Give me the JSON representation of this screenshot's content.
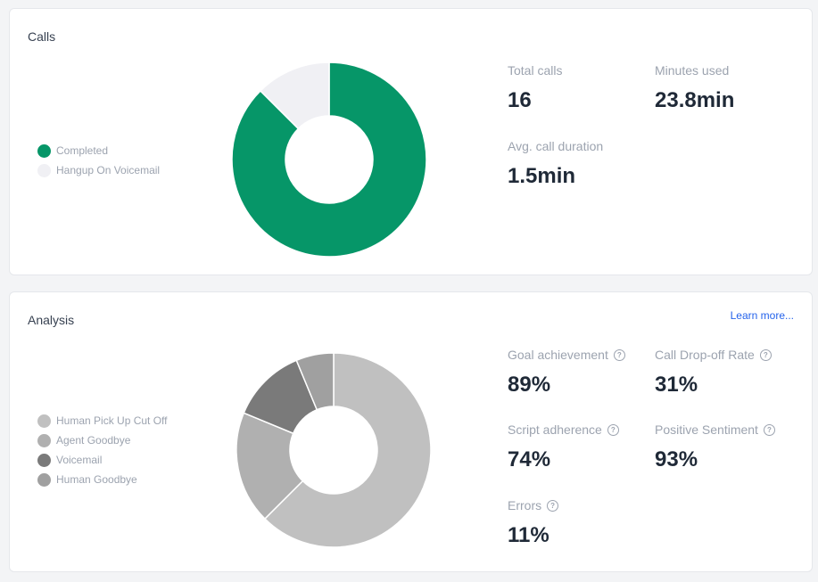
{
  "calls": {
    "title": "Calls",
    "legend": [
      {
        "label": "Completed",
        "color": "#069668"
      },
      {
        "label": "Hangup On Voicemail",
        "color": "#f0f0f4"
      }
    ],
    "chart_data": {
      "type": "pie",
      "donut": true,
      "categories": [
        "Completed",
        "Hangup On Voicemail"
      ],
      "values": [
        14,
        2
      ],
      "colors": [
        "#069668",
        "#f0f0f4"
      ]
    },
    "stats": {
      "total_calls_label": "Total calls",
      "total_calls_value": "16",
      "minutes_used_label": "Minutes used",
      "minutes_used_value": "23.8min",
      "avg_duration_label": "Avg. call duration",
      "avg_duration_value": "1.5min"
    }
  },
  "analysis": {
    "title": "Analysis",
    "learn_more": "Learn more...",
    "legend": [
      {
        "label": "Human Pick Up Cut Off",
        "color": "#c0c0c0"
      },
      {
        "label": "Agent Goodbye",
        "color": "#b0b0b0"
      },
      {
        "label": "Voicemail",
        "color": "#7a7a7a"
      },
      {
        "label": "Human Goodbye",
        "color": "#a0a0a0"
      }
    ],
    "chart_data": {
      "type": "pie",
      "donut": true,
      "categories": [
        "Human Pick Up Cut Off",
        "Agent Goodbye",
        "Voicemail",
        "Human Goodbye"
      ],
      "values": [
        10,
        3,
        2,
        1
      ],
      "colors": [
        "#c0c0c0",
        "#b0b0b0",
        "#7a7a7a",
        "#a0a0a0"
      ]
    },
    "stats": {
      "goal_label": "Goal achievement",
      "goal_value": "89%",
      "dropoff_label": "Call Drop-off Rate",
      "dropoff_value": "31%",
      "script_label": "Script adherence",
      "script_value": "74%",
      "sentiment_label": "Positive Sentiment",
      "sentiment_value": "93%",
      "errors_label": "Errors",
      "errors_value": "11%"
    },
    "help_icon": "question-circle-icon"
  }
}
